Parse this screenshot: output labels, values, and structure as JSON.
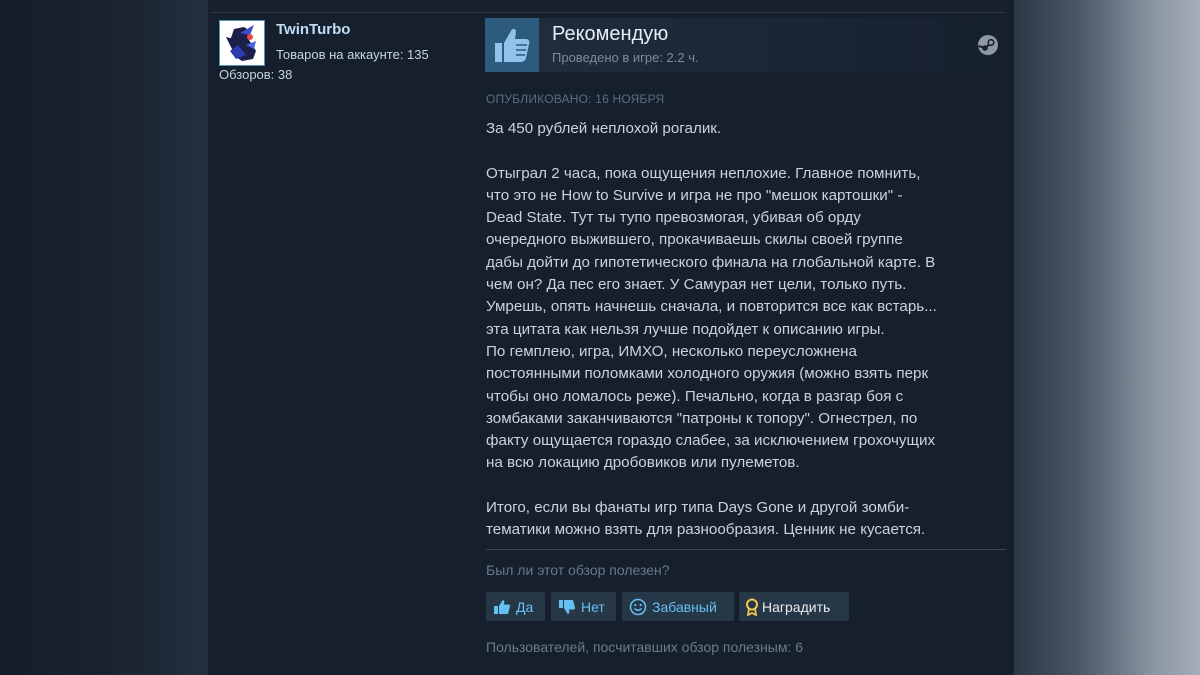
{
  "author": {
    "name": "TwinTurbo",
    "products_text": "Товаров на аккаунте: 135",
    "reviews_text": "Обзоров: 38"
  },
  "review": {
    "verdict": "Рекомендую",
    "hours_text": "Проведено в игре: 2.2 ч.",
    "posted_text": "ОПУБЛИКОВАНО: 16 НОЯБРЯ",
    "lines": [
      "За 450 рублей неплохой рогалик.",
      "",
      "Отыграл 2 часа, пока ощущения неплохие. Главное помнить,",
      "что это не How to Survive и игра не про \"мешок картошки\" -",
      "Dead State. Тут ты тупо превозмогая, убивая об орду",
      "очередного выжившего, прокачиваешь скилы своей группе",
      "дабы дойти до гипотетического финала на глобальной карте. В",
      "чем он? Да пес его знает. У Самурая нет цели, только путь.",
      "Умрешь, опять начнешь сначала, и повторится все как встарь...",
      "эта цитата как нельзя лучше подойдет к описанию игры.",
      "По гемплею, игра, ИМХО, несколько переусложнена",
      "постоянными поломками холодного оружия (можно взять перк",
      "чтобы оно ломалось реже). Печально, когда в разгар боя с",
      "зомбаками заканчиваются \"патроны к топору\". Огнестрел, по",
      "факту ощущается гораздо слабее, за исключением грохочущих",
      "на всю локацию дробовиков или пулеметов.",
      "",
      "Итого, если вы фанаты игр типа Days Gone и другой зомби-",
      "тематики можно взять для разнообразия. Ценник не кусается."
    ]
  },
  "feedback": {
    "question": "Был ли этот обзор полезен?",
    "yes_label": "Да",
    "no_label": "Нет",
    "funny_label": "Забавный",
    "award_label": "Наградить",
    "helpful_count_text": "Пользователей, посчитавших обзор полезным: 6"
  },
  "colors": {
    "accent": "#66c0f4",
    "panel_bg": "#16202d",
    "thumb_bg": "#2c5b7d"
  },
  "icons": {
    "thumbs_up": "thumbs-up-icon",
    "steam": "steam-icon",
    "thumbs_down": "thumbs-down-icon",
    "smiley": "smiley-icon",
    "award": "award-ribbon-icon"
  }
}
